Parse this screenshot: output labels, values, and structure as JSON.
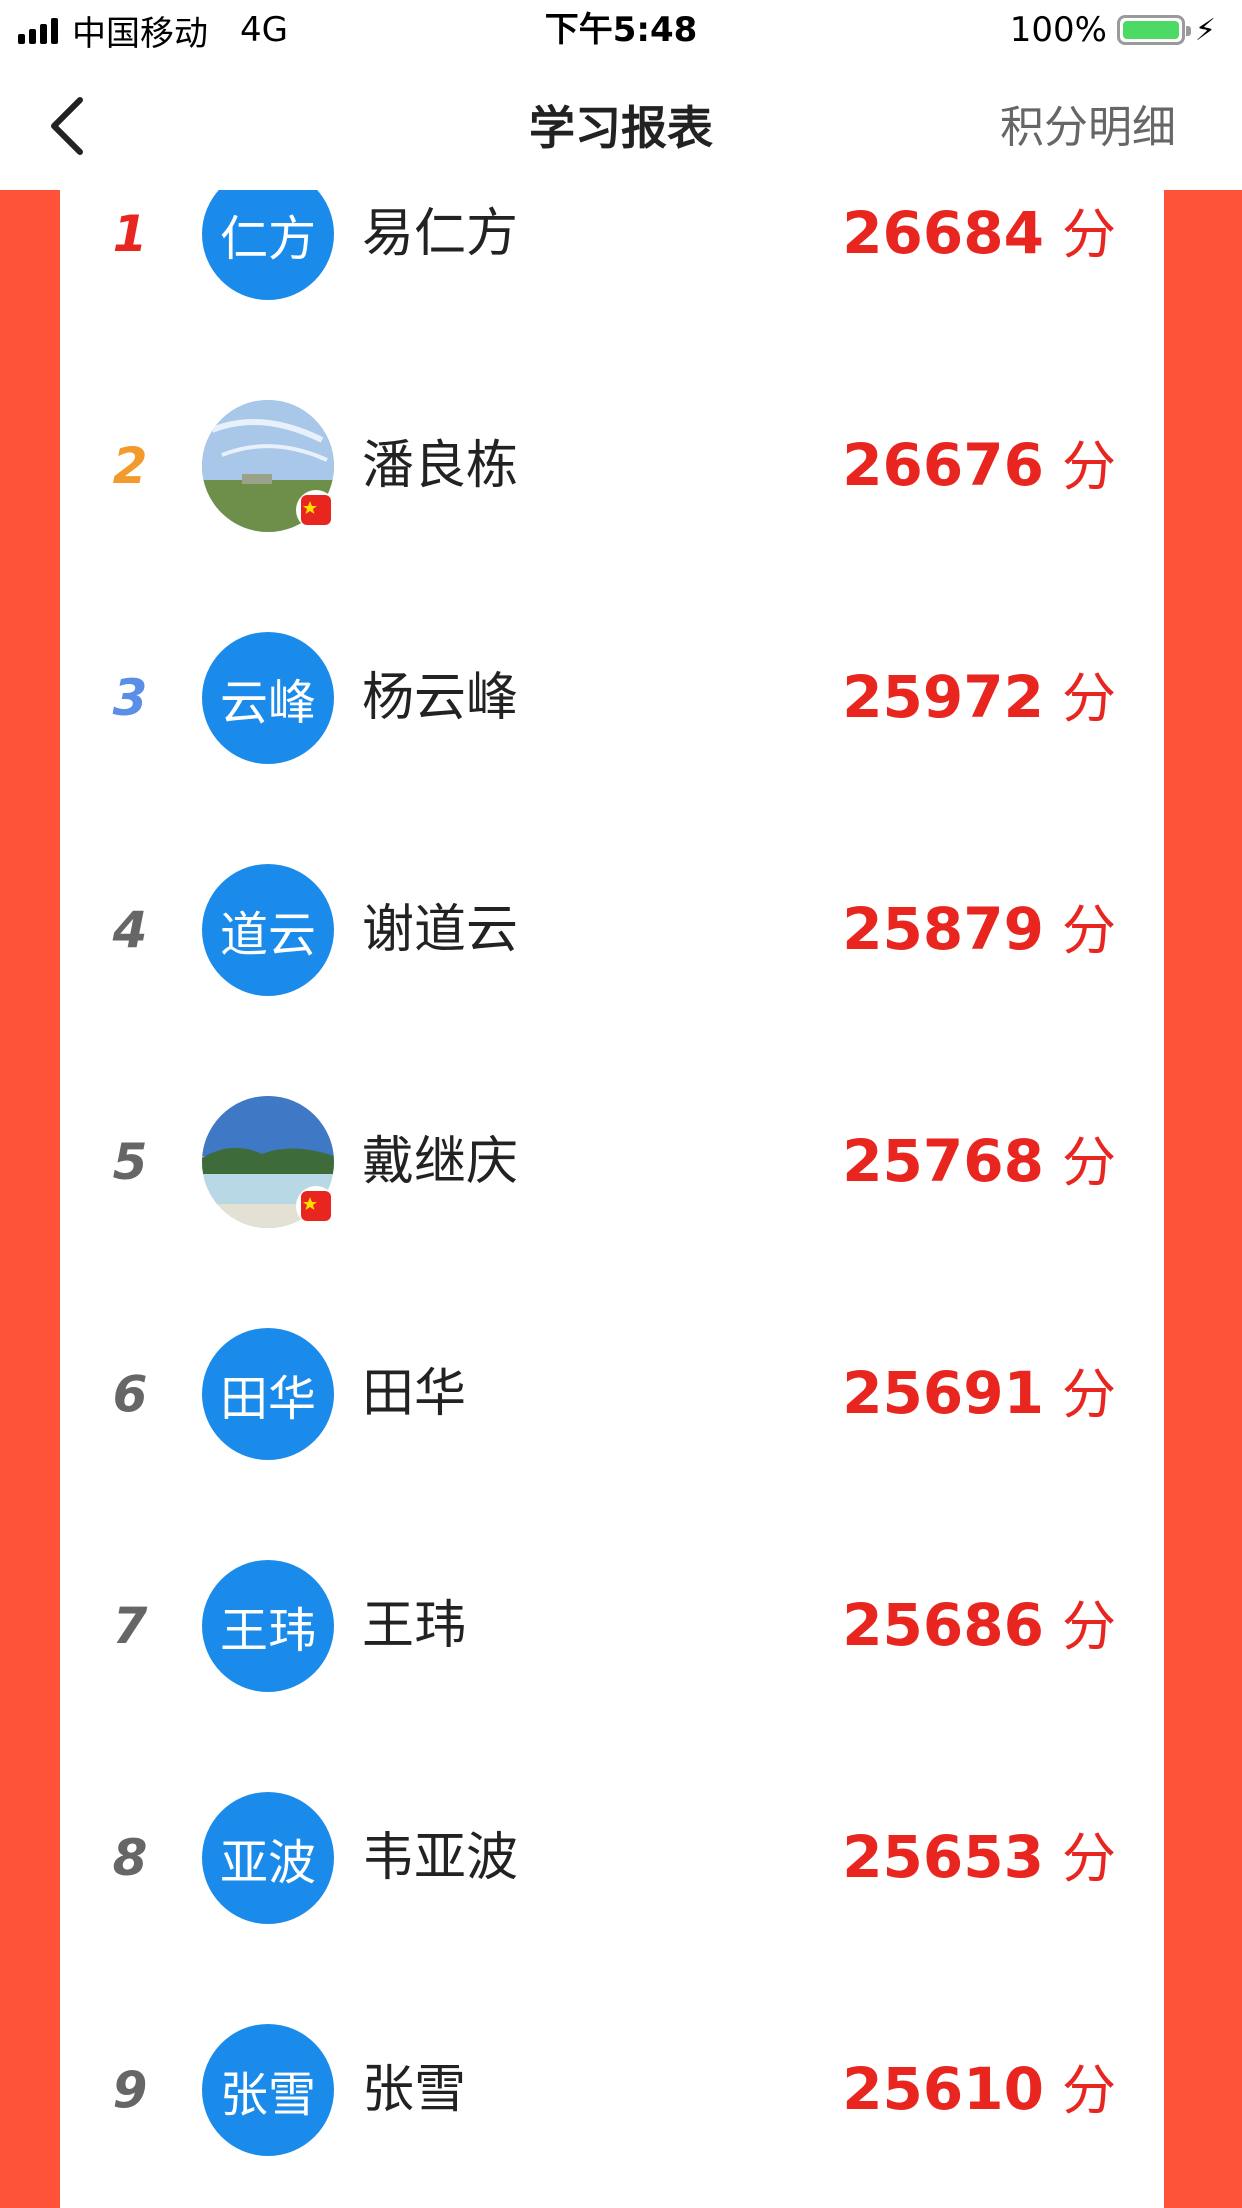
{
  "status_bar": {
    "carrier": "中国移动",
    "network": "4G",
    "time": "下午5:48",
    "battery": "100%"
  },
  "nav": {
    "title": "学习报表",
    "right_link": "积分明细"
  },
  "colors": {
    "accent_red": "#fe5338",
    "score_red": "#e8261f",
    "avatar_blue": "#1a8bea",
    "rank1": "#e8261f",
    "rank2": "#f39a2d",
    "rank3": "#5b8ee6",
    "rank_other": "#666666"
  },
  "list": [
    {
      "rank": "1",
      "avatar_text": "仁方",
      "name": "易仁方",
      "score": "26684",
      "unit": "分"
    },
    {
      "rank": "2",
      "avatar_text": "",
      "name": "潘良栋",
      "score": "26676",
      "unit": "分"
    },
    {
      "rank": "3",
      "avatar_text": "云峰",
      "name": "杨云峰",
      "score": "25972",
      "unit": "分"
    },
    {
      "rank": "4",
      "avatar_text": "道云",
      "name": "谢道云",
      "score": "25879",
      "unit": "分"
    },
    {
      "rank": "5",
      "avatar_text": "",
      "name": "戴继庆",
      "score": "25768",
      "unit": "分"
    },
    {
      "rank": "6",
      "avatar_text": "田华",
      "name": "田华",
      "score": "25691",
      "unit": "分"
    },
    {
      "rank": "7",
      "avatar_text": "王玮",
      "name": "王玮",
      "score": "25686",
      "unit": "分"
    },
    {
      "rank": "8",
      "avatar_text": "亚波",
      "name": "韦亚波",
      "score": "25653",
      "unit": "分"
    },
    {
      "rank": "9",
      "avatar_text": "张雪",
      "name": "张雪",
      "score": "25610",
      "unit": "分"
    }
  ]
}
